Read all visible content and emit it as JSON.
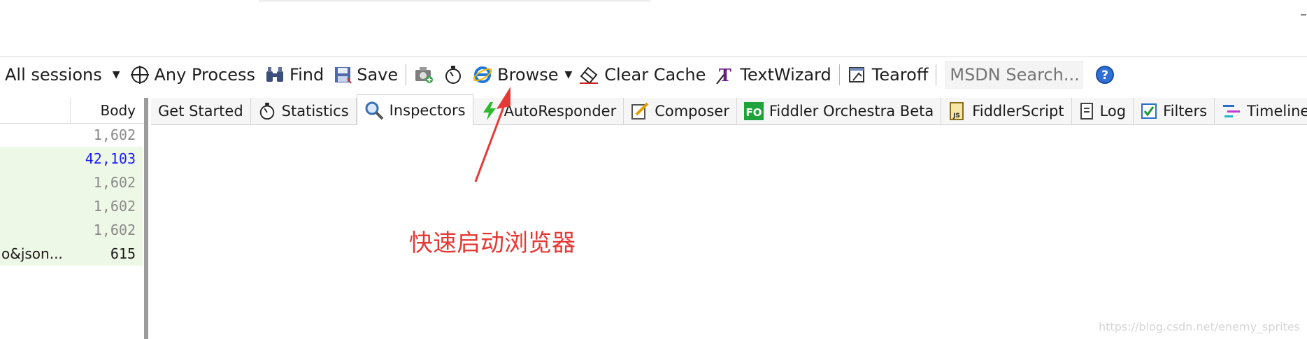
{
  "app": "Fiddler",
  "toolbar": {
    "sessions_filter": "All sessions",
    "any_process": "Any Process",
    "find": "Find",
    "save": "Save",
    "browse": "Browse",
    "clear_cache": "Clear Cache",
    "text_wizard": "TextWizard",
    "tearoff": "Tearoff",
    "search_placeholder": "MSDN Search..."
  },
  "session_list": {
    "column_header": "Body",
    "rows": [
      {
        "left": "",
        "body": "1,602",
        "color": "#8a8a8a"
      },
      {
        "left": "",
        "body": "42,103",
        "color": "#1a1aff"
      },
      {
        "left": "",
        "body": "1,602",
        "color": "#8a8a8a"
      },
      {
        "left": "",
        "body": "1,602",
        "color": "#8a8a8a"
      },
      {
        "left": "",
        "body": "1,602",
        "color": "#8a8a8a"
      },
      {
        "left": "o&json...",
        "body": "615",
        "color": "#1b1b1b"
      }
    ]
  },
  "tabs": [
    {
      "label": "Get Started",
      "icon": "none"
    },
    {
      "label": "Statistics",
      "icon": "stopwatch-icon"
    },
    {
      "label": "Inspectors",
      "icon": "magnifier-icon",
      "active": true
    },
    {
      "label": "AutoResponder",
      "icon": "lightning-icon"
    },
    {
      "label": "Composer",
      "icon": "pencil-icon"
    },
    {
      "label": "Fiddler Orchestra Beta",
      "icon": "fo-icon"
    },
    {
      "label": "FiddlerScript",
      "icon": "script-icon"
    },
    {
      "label": "Log",
      "icon": "log-icon"
    },
    {
      "label": "Filters",
      "icon": "checkbox-icon"
    },
    {
      "label": "Timeline",
      "icon": "timeline-icon"
    }
  ],
  "annotation": {
    "text": "快速启动浏览器",
    "color": "#e53935"
  },
  "watermark": "https://blog.csdn.net/enemy_sprites",
  "colors": {
    "row_green": "#eef8e6",
    "fo_badge": "#1fa33a",
    "help_blue": "#2f6fd6"
  }
}
